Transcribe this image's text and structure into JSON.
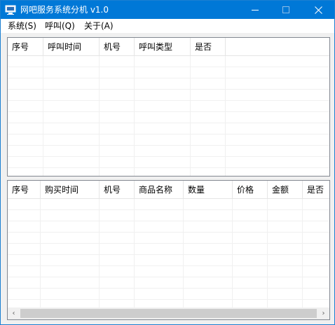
{
  "window": {
    "title": "网吧服务系统分机 v1.0",
    "app_icon": "computer-app-icon",
    "controls": {
      "minimize_icon": "minimize-icon",
      "maximize_icon": "maximize-icon",
      "close_icon": "close-icon",
      "close_glyph": "✕"
    }
  },
  "menubar": {
    "items": [
      {
        "label": "系统(S)"
      },
      {
        "label": "呼叫(Q)"
      },
      {
        "label": "关于(A)"
      }
    ]
  },
  "call_list": {
    "columns": [
      {
        "label": "序号"
      },
      {
        "label": "呼叫时间"
      },
      {
        "label": "机号"
      },
      {
        "label": "呼叫类型"
      },
      {
        "label": "是否"
      }
    ],
    "rows": []
  },
  "purchase_list": {
    "columns": [
      {
        "label": "序号"
      },
      {
        "label": "购买时间"
      },
      {
        "label": "机号"
      },
      {
        "label": "商品名称"
      },
      {
        "label": "数量"
      },
      {
        "label": "价格"
      },
      {
        "label": "金额"
      },
      {
        "label": "是否"
      }
    ],
    "rows": [],
    "scrollbar": {
      "left_glyph": "‹",
      "right_glyph": "›"
    }
  }
}
